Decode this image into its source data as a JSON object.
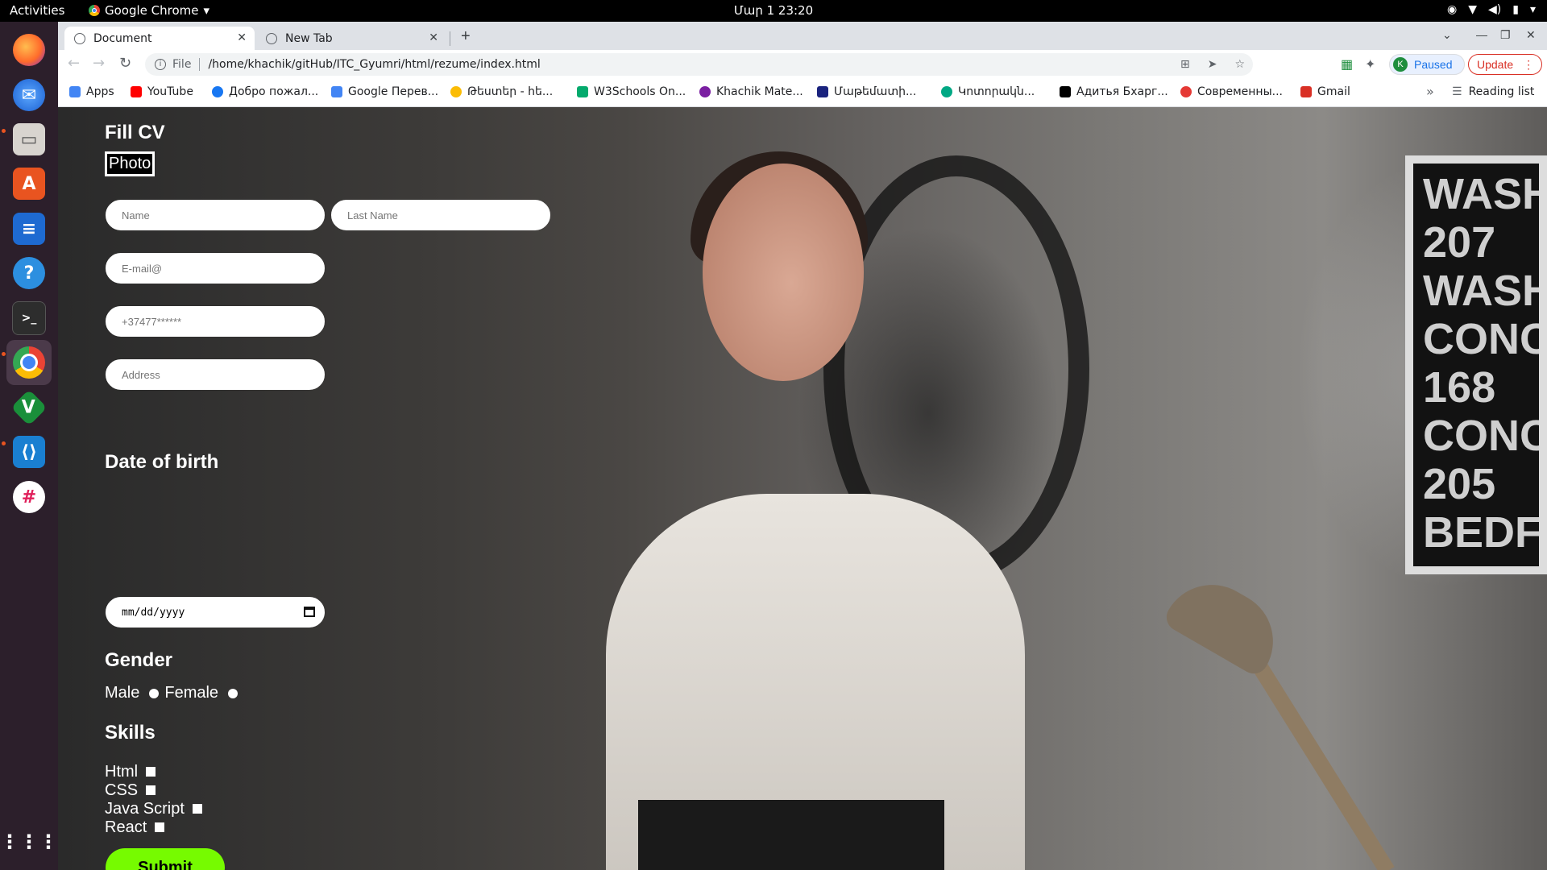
{
  "system": {
    "activities": "Activities",
    "app_name": "Google Chrome",
    "clock": "Մար 1  23:20"
  },
  "browser": {
    "tabs": [
      {
        "title": "Document",
        "active": true
      },
      {
        "title": "New Tab",
        "active": false
      }
    ],
    "omnibox": {
      "scheme": "File",
      "url": "/home/khachik/gitHub/ITC_Gyumri/html/rezume/index.html"
    },
    "profile": {
      "initial": "K",
      "label": "Paused"
    },
    "update_label": "Update",
    "bookmarks": [
      {
        "label": "Apps",
        "color": "#4285f4"
      },
      {
        "label": "YouTube",
        "color": "#ff0000"
      },
      {
        "label": "Добро пожал...",
        "color": "#1877f2"
      },
      {
        "label": "Google Перев...",
        "color": "#4285f4"
      },
      {
        "label": "Թեստեր - հե...",
        "color": "#fbbc05"
      },
      {
        "label": "W3Schools On...",
        "color": "#04aa6d"
      },
      {
        "label": "Khachik Mate...",
        "color": "#7b1fa2"
      },
      {
        "label": "Մաթեմատի...",
        "color": "#1a237e"
      },
      {
        "label": "Կոտորակն...",
        "color": "#00a884"
      },
      {
        "label": "Адитья Бхарг...",
        "color": "#000000"
      },
      {
        "label": "Современны...",
        "color": "#e53935"
      },
      {
        "label": "Gmail",
        "color": "#d93025"
      }
    ],
    "reading_list": "Reading list"
  },
  "form": {
    "title": "Fill CV",
    "photo_label": "Photo",
    "placeholders": {
      "name": "Name",
      "last_name": "Last Name",
      "email": "E-mail@",
      "phone": "+37477******",
      "address": "Address"
    },
    "date_section": "Date of birth",
    "date_value": "mm/dd/yyyy",
    "gender_section": "Gender",
    "gender_options": [
      "Male",
      "Female"
    ],
    "skills_section": "Skills",
    "skills": [
      "Html",
      "CSS",
      "Java Script",
      "React"
    ],
    "submit_label": "Submit",
    "accent_color": "#76fb00"
  },
  "background": {
    "poster_lines": [
      "WASH",
      "207",
      "WASH",
      "CONCO",
      "168",
      "CONCO",
      "205",
      "BEDFO"
    ]
  }
}
